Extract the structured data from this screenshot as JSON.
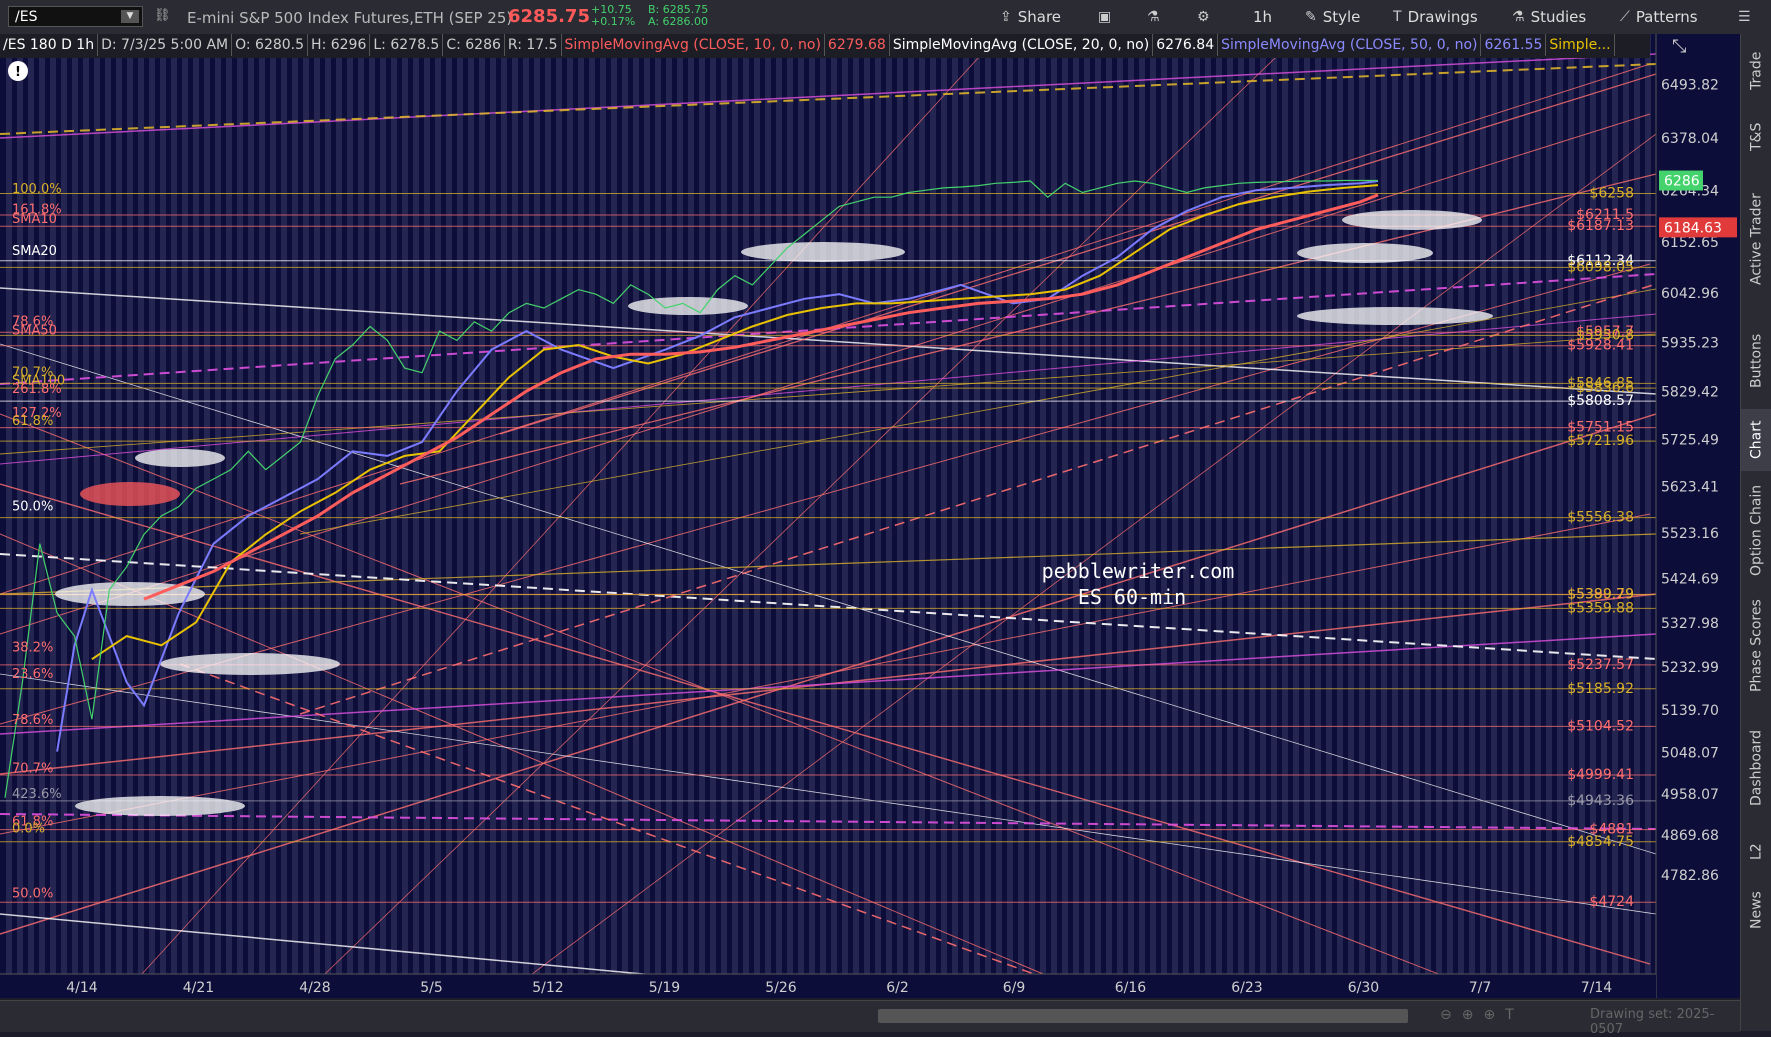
{
  "toolbar": {
    "symbol": "/ES",
    "description": "E-mini S&P 500 Index Futures,ETH (SEP 25)",
    "last_price": "6285.75",
    "change": "+10.75",
    "change_pct": "+0.17%",
    "bid": "B: 6285.75",
    "ask": "A: 6286.00",
    "share_label": "Share",
    "interval_label": "1h",
    "style_label": "Style",
    "drawings_label": "Drawings",
    "studies_label": "Studies",
    "patterns_label": "Patterns"
  },
  "infobar": {
    "period": "/ES 180 D 1h",
    "date": "D: 7/3/25 5:00 AM",
    "open": "O: 6280.5",
    "high": "H: 6296",
    "low": "L: 6278.5",
    "close": "C: 6286",
    "range": "R: 17.5",
    "sma10_label": "SimpleMovingAvg (CLOSE, 10, 0, no)",
    "sma10_value": "6279.68",
    "sma20_label": "SimpleMovingAvg (CLOSE, 20, 0, no)",
    "sma20_value": "6276.84",
    "sma50_label": "SimpleMovingAvg (CLOSE, 50, 0, no)",
    "sma50_value": "6261.55",
    "more_label": "Simple..."
  },
  "right_tabs": [
    "Trade",
    "T&S",
    "Active Trader",
    "Buttons",
    "Chart",
    "Option Chain",
    "Phase Scores",
    "Dashboard",
    "L2",
    "News"
  ],
  "bottom": {
    "drawing_set": "Drawing set: 2025-0507"
  },
  "watermark": {
    "line1": "pebblewriter.com",
    "line2": "ES 60-min"
  },
  "colors": {
    "background": "#0d0d3a",
    "stripe": "#3a3a64",
    "price_up": "#43d26b",
    "price_down": "#ff5a5a",
    "sma10": "#7b7bff",
    "sma20": "#e8c200",
    "sma50": "#ff5c5c",
    "fib_gold": "#d9b12a",
    "fib_pink": "#ff6f6f",
    "magenta": "#e050e0"
  },
  "chart_data": {
    "type": "line",
    "title": "",
    "x_ticks": [
      "4/14",
      "4/21",
      "4/28",
      "5/5",
      "5/12",
      "5/19",
      "5/26",
      "6/2",
      "6/9",
      "6/16",
      "6/23",
      "6/30",
      "7/7",
      "7/14"
    ],
    "y_ticks": [
      6493.82,
      6378.04,
      6264.34,
      6152.65,
      6042.96,
      5935.23,
      5829.42,
      5725.49,
      5623.41,
      5523.16,
      5424.69,
      5327.98,
      5232.99,
      5139.7,
      5048.07,
      4958.07,
      4869.68,
      4782.86
    ],
    "ylim": [
      4720,
      6580
    ],
    "last_price_label": "6286",
    "last_price": 6286,
    "marker_label": "6184.63",
    "marker_price": 6184.63,
    "series": [
      {
        "name": "SMA10",
        "x": [
          3,
          4,
          5,
          6,
          7,
          8,
          9,
          10,
          12,
          14,
          16,
          18,
          20,
          22,
          24,
          26,
          28,
          30,
          32,
          35,
          38,
          40,
          42,
          44,
          46,
          48,
          50,
          52,
          55,
          58,
          60,
          62,
          64,
          66,
          68,
          70,
          72,
          74,
          76,
          78,
          79
        ],
        "y": [
          5050,
          5280,
          5400,
          5300,
          5200,
          5150,
          5250,
          5350,
          5500,
          5560,
          5600,
          5640,
          5700,
          5690,
          5720,
          5830,
          5920,
          5960,
          5920,
          5880,
          5920,
          5950,
          5990,
          6010,
          6030,
          6040,
          6020,
          6030,
          6060,
          6020,
          6030,
          6080,
          6120,
          6180,
          6220,
          6250,
          6265,
          6270,
          6276,
          6280,
          6285
        ]
      },
      {
        "name": "SMA20",
        "x": [
          5,
          7,
          9,
          11,
          13,
          15,
          17,
          19,
          21,
          23,
          25,
          27,
          29,
          31,
          33,
          35,
          37,
          39,
          41,
          43,
          45,
          47,
          49,
          51,
          53,
          55,
          57,
          59,
          61,
          63,
          65,
          67,
          69,
          71,
          73,
          75,
          77,
          79
        ],
        "y": [
          5250,
          5300,
          5280,
          5330,
          5460,
          5520,
          5570,
          5610,
          5660,
          5690,
          5700,
          5780,
          5860,
          5920,
          5930,
          5905,
          5890,
          5910,
          5940,
          5970,
          5995,
          6010,
          6020,
          6020,
          6025,
          6030,
          6035,
          6040,
          6050,
          6080,
          6130,
          6180,
          6210,
          6235,
          6250,
          6262,
          6270,
          6276
        ]
      },
      {
        "name": "SMA50",
        "x": [
          8,
          10,
          12,
          14,
          16,
          18,
          20,
          22,
          24,
          26,
          28,
          30,
          32,
          34,
          36,
          38,
          40,
          42,
          44,
          46,
          48,
          50,
          52,
          54,
          56,
          58,
          60,
          62,
          64,
          66,
          68,
          70,
          72,
          74,
          76,
          78,
          79
        ],
        "y": [
          5380,
          5410,
          5440,
          5480,
          5520,
          5560,
          5610,
          5650,
          5690,
          5730,
          5780,
          5830,
          5870,
          5900,
          5910,
          5910,
          5915,
          5925,
          5940,
          5955,
          5970,
          5985,
          6000,
          6010,
          6020,
          6025,
          6030,
          6040,
          6060,
          6090,
          6120,
          6150,
          6180,
          6200,
          6220,
          6240,
          6255
        ]
      },
      {
        "name": "Price",
        "x": [
          0,
          1,
          2,
          3,
          4,
          5,
          6,
          7,
          8,
          9,
          10,
          11,
          12,
          13,
          14,
          15,
          16,
          17,
          18,
          19,
          20,
          21,
          22,
          23,
          24,
          25,
          26,
          27,
          28,
          29,
          30,
          31,
          32,
          33,
          34,
          35,
          36,
          37,
          38,
          39,
          40,
          41,
          42,
          43,
          44,
          45,
          46,
          47,
          48,
          49,
          50,
          51,
          52,
          53,
          54,
          55,
          56,
          57,
          58,
          59,
          60,
          61,
          62,
          63,
          64,
          65,
          66,
          67,
          68,
          69,
          70,
          71,
          72,
          73,
          74,
          75,
          76,
          77,
          78,
          79
        ],
        "y": [
          4950,
          5200,
          5500,
          5350,
          5300,
          5120,
          5400,
          5450,
          5520,
          5560,
          5580,
          5620,
          5640,
          5660,
          5700,
          5660,
          5690,
          5720,
          5820,
          5900,
          5930,
          5970,
          5940,
          5880,
          5870,
          5960,
          5940,
          5980,
          5960,
          6000,
          6020,
          6010,
          6030,
          6050,
          6040,
          6020,
          6060,
          6040,
          6010,
          6020,
          6000,
          6050,
          6080,
          6060,
          6100,
          6140,
          6170,
          6200,
          6230,
          6240,
          6250,
          6250,
          6260,
          6265,
          6270,
          6272,
          6275,
          6280,
          6282,
          6285,
          6250,
          6280,
          6260,
          6270,
          6280,
          6285,
          6280,
          6270,
          6260,
          6270,
          6275,
          6280,
          6282,
          6283,
          6284,
          6285,
          6285,
          6286,
          6286,
          6286
        ]
      }
    ],
    "level_labels_right": [
      {
        "text": "$6258",
        "value": 6258,
        "color": "gold"
      },
      {
        "text": "$6211.5",
        "value": 6211.5,
        "color": "pink"
      },
      {
        "text": "$6187.13",
        "value": 6187.13,
        "color": "pink"
      },
      {
        "text": "$6112.34",
        "value": 6112.34,
        "color": "white"
      },
      {
        "text": "$6098.05",
        "value": 6098.05,
        "color": "gold"
      },
      {
        "text": "$5957.7",
        "value": 5957.7,
        "color": "pink"
      },
      {
        "text": "$5950.8",
        "value": 5950.8,
        "color": "gold"
      },
      {
        "text": "$5928.41",
        "value": 5928.41,
        "color": "pink"
      },
      {
        "text": "$5846.85",
        "value": 5846.85,
        "color": "gold"
      },
      {
        "text": "$5836.6",
        "value": 5836.6,
        "color": "gold"
      },
      {
        "text": "$5808.57",
        "value": 5808.57,
        "color": "white"
      },
      {
        "text": "$5751.15",
        "value": 5751.15,
        "color": "pink"
      },
      {
        "text": "$5721.96",
        "value": 5721.96,
        "color": "gold"
      },
      {
        "text": "$5556.38",
        "value": 5556.38,
        "color": "gold"
      },
      {
        "text": "$5390.29",
        "value": 5390.29,
        "color": "pink"
      },
      {
        "text": "$5389.79",
        "value": 5389.79,
        "color": "gold"
      },
      {
        "text": "$5359.88",
        "value": 5359.88,
        "color": "gold"
      },
      {
        "text": "$5237.57",
        "value": 5237.57,
        "color": "pink"
      },
      {
        "text": "$5185.92",
        "value": 5185.92,
        "color": "gold"
      },
      {
        "text": "$5104.52",
        "value": 5104.52,
        "color": "pink"
      },
      {
        "text": "$4999.41",
        "value": 4999.41,
        "color": "pink"
      },
      {
        "text": "$4943.36",
        "value": 4943.36,
        "color": "gray"
      },
      {
        "text": "$4881",
        "value": 4881,
        "color": "pink"
      },
      {
        "text": "$4854.75",
        "value": 4854.75,
        "color": "gold"
      },
      {
        "text": "$4724",
        "value": 4724,
        "color": "pink"
      }
    ],
    "level_labels_left": [
      {
        "text": "100.0%",
        "value": 6255,
        "color": "gold"
      },
      {
        "text": "161.8%",
        "value": 6210,
        "color": "pink"
      },
      {
        "text": "SMA10",
        "value": 6190,
        "color": "pink"
      },
      {
        "text": "SMA20",
        "value": 6120,
        "color": "white"
      },
      {
        "text": "78.6%",
        "value": 5968,
        "color": "pink"
      },
      {
        "text": "SMA50",
        "value": 5948,
        "color": "pink"
      },
      {
        "text": "70.7%",
        "value": 5858,
        "color": "gold"
      },
      {
        "text": "SMA100",
        "value": 5840,
        "color": "gold"
      },
      {
        "text": "261.8%",
        "value": 5822,
        "color": "pink"
      },
      {
        "text": "127.2%",
        "value": 5770,
        "color": "pink"
      },
      {
        "text": "61.8%",
        "value": 5752,
        "color": "gold"
      },
      {
        "text": "50.0%",
        "value": 5568,
        "color": "white"
      },
      {
        "text": "38.2%",
        "value": 5262,
        "color": "pink"
      },
      {
        "text": "23.6%",
        "value": 5205,
        "color": "pink"
      },
      {
        "text": "78.6%",
        "value": 5105,
        "color": "pink"
      },
      {
        "text": "70.7%",
        "value": 5000,
        "color": "pink"
      },
      {
        "text": "423.6%",
        "value": 4945,
        "color": "gray"
      },
      {
        "text": "61.8%",
        "value": 4886,
        "color": "pink"
      },
      {
        "text": "0.0%",
        "value": 4870,
        "color": "gold"
      },
      {
        "text": "50.0%",
        "value": 4730,
        "color": "pink"
      }
    ],
    "grid": false
  }
}
